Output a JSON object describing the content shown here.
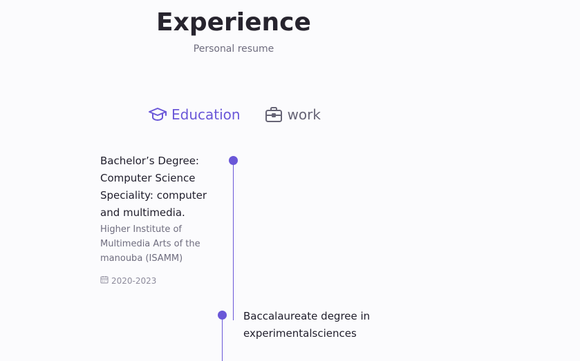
{
  "header": {
    "title": "Experience",
    "subtitle": "Personal resume"
  },
  "tabs": [
    {
      "label": "Education",
      "icon": "graduation-cap-icon",
      "active": true
    },
    {
      "label": "work",
      "icon": "briefcase-icon",
      "active": false
    }
  ],
  "timeline": [
    {
      "title": "Bachelor’s Degree: Computer Science Speciality: computer and multimedia.",
      "institution": "Higher Institute of Multimedia Arts of the manouba (ISAMM)",
      "date": "2020-2023",
      "date_icon": "calendar-icon"
    },
    {
      "title": "Baccalaureate degree in experimentalsciences"
    }
  ],
  "colors": {
    "accent": "#6a57d8",
    "text": "#1f1d2b",
    "muted": "#6e6c7e",
    "background": "#fbfbfd"
  }
}
